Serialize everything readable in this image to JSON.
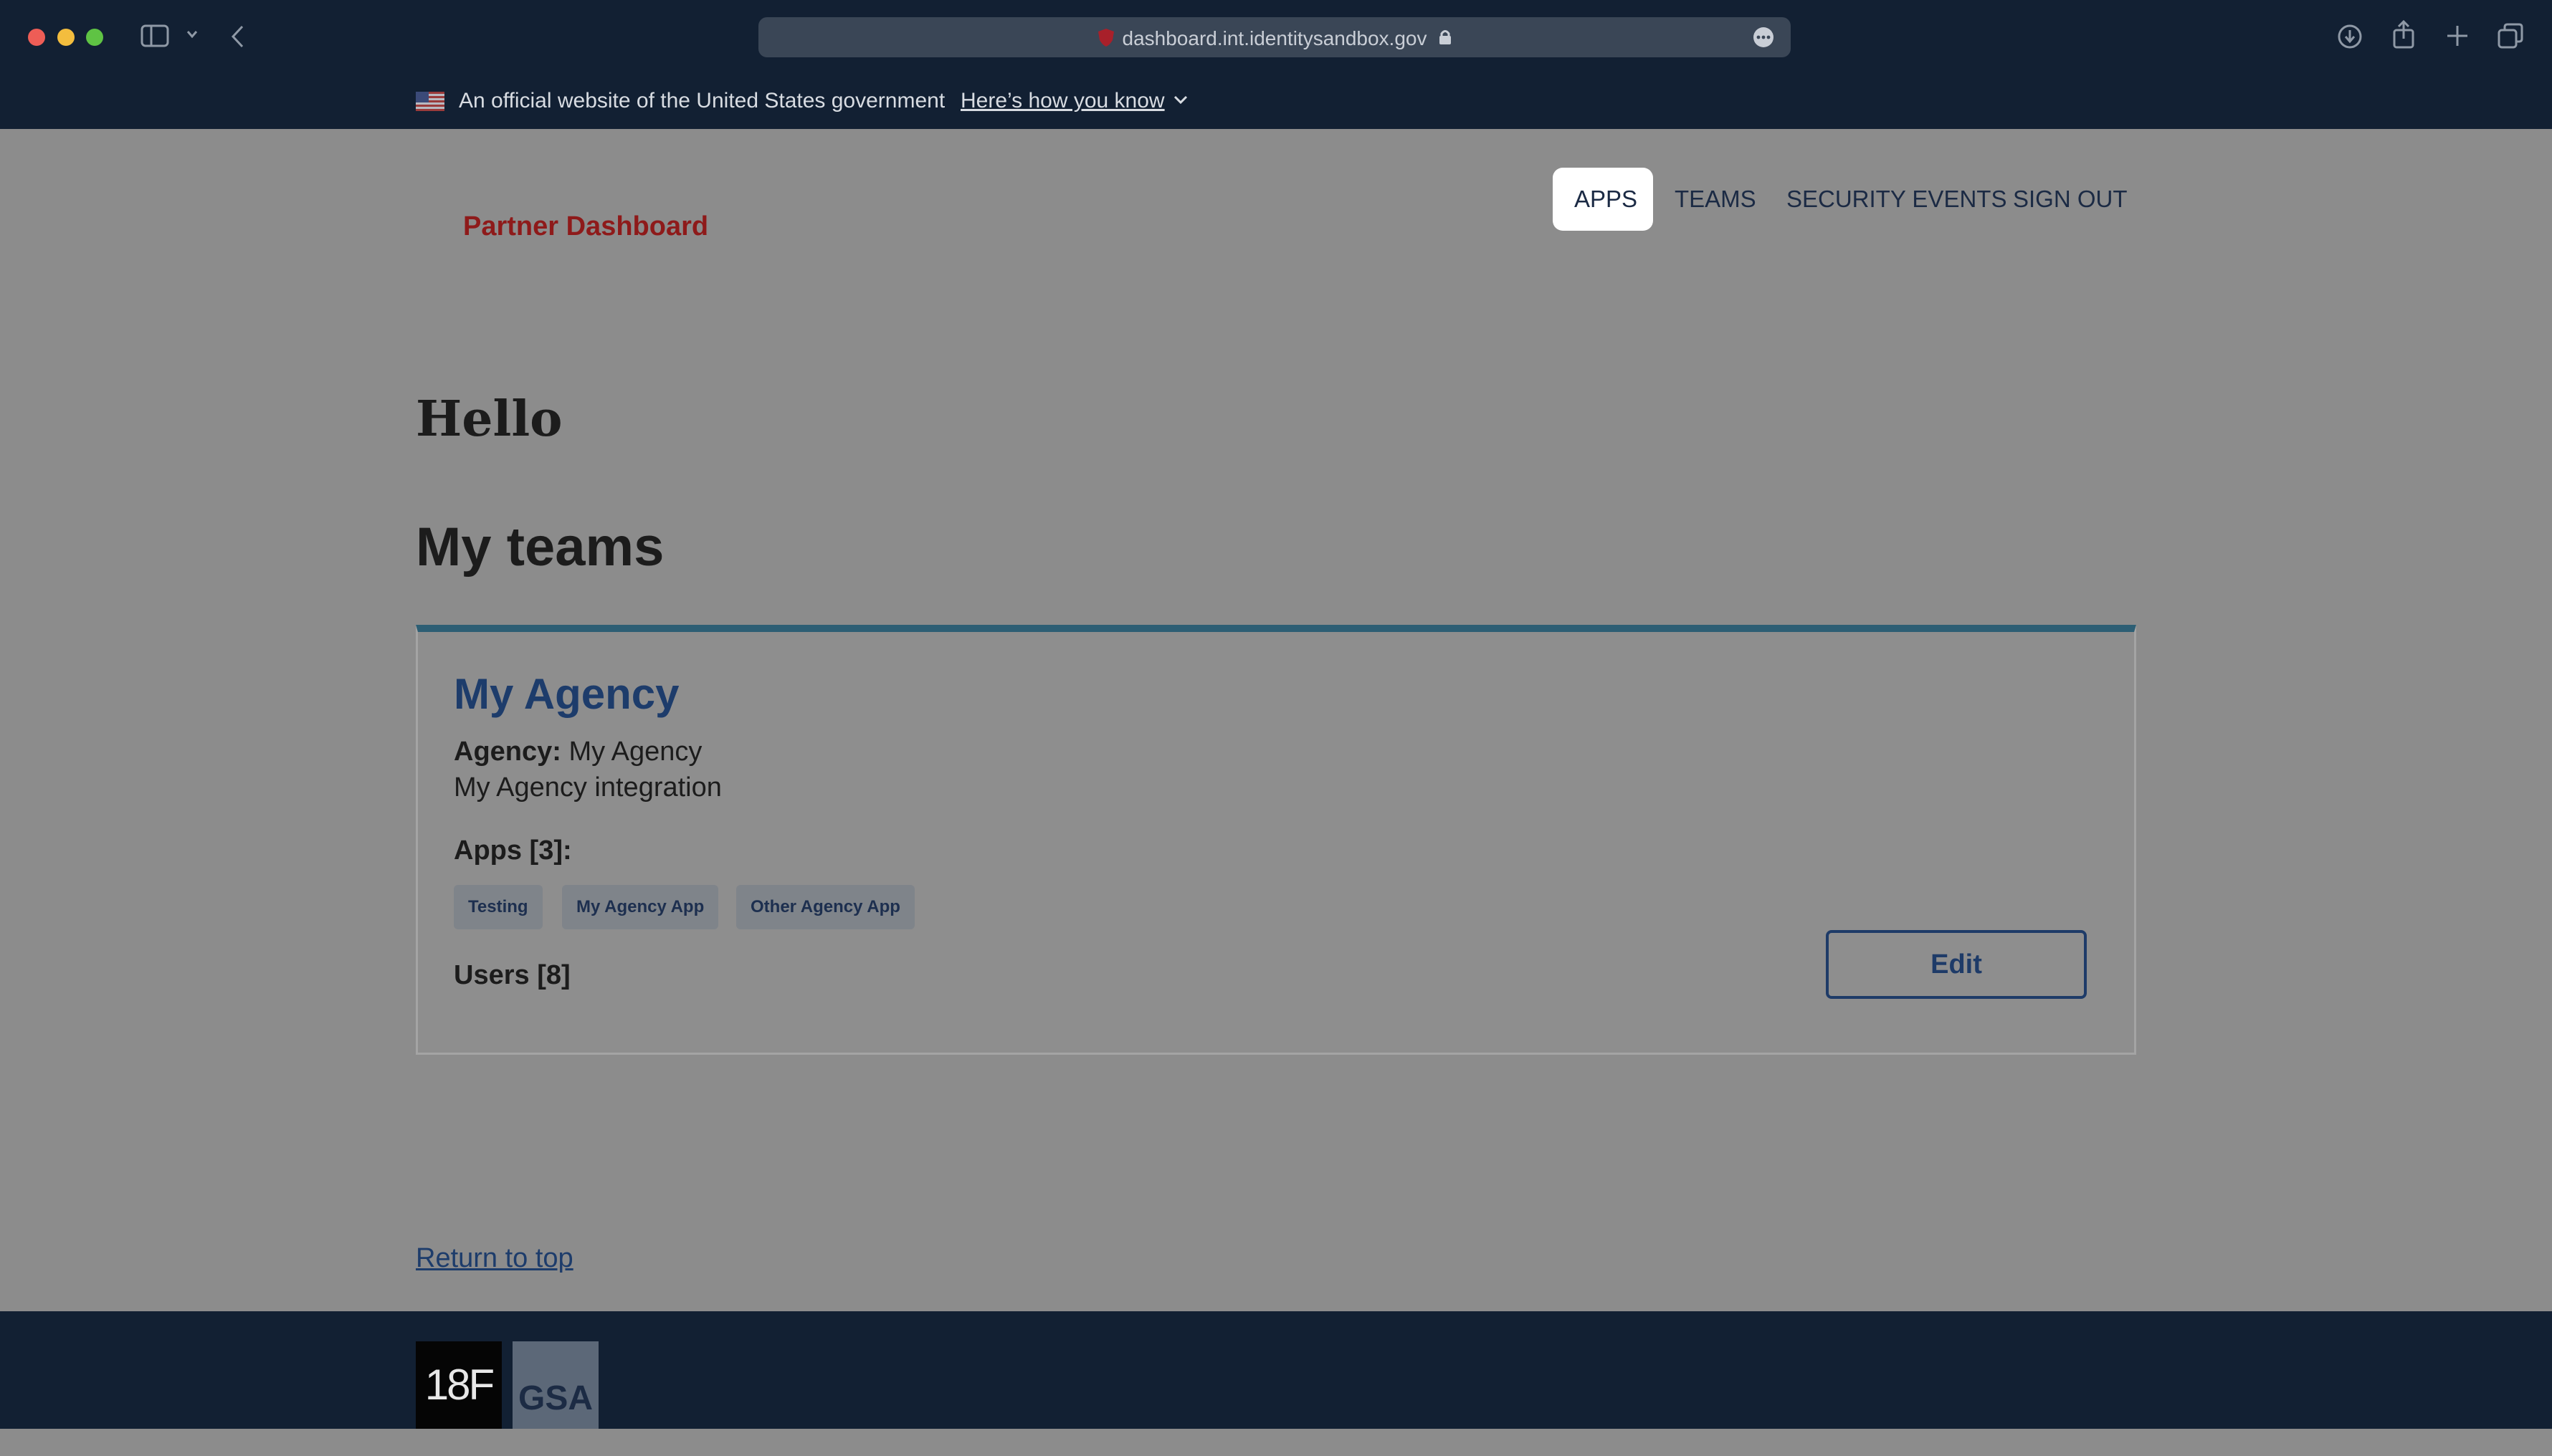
{
  "browser": {
    "url": "dashboard.int.identitysandbox.gov"
  },
  "gov_banner": {
    "text": "An official website of the United States government",
    "link": "Here’s how you know"
  },
  "header": {
    "brand": "Partner Dashboard",
    "nav": [
      "APPS",
      "TEAMS",
      "SECURITY EVENTS",
      "SIGN OUT"
    ],
    "active_nav": "APPS"
  },
  "main": {
    "greeting": "Hello",
    "section_title": "My teams",
    "team": {
      "name": "My Agency",
      "agency_label": "Agency:",
      "agency_value": "My Agency",
      "description": "My Agency integration",
      "apps_label": "Apps [3]:",
      "apps": [
        "Testing",
        "My Agency App",
        "Other Agency App"
      ],
      "users_label": "Users [8]",
      "edit_label": "Edit"
    },
    "return_to_top": "Return to top"
  },
  "footer": {
    "logo_18f": "18F",
    "logo_gsa": "GSA"
  },
  "colors": {
    "chrome_bg": "#122033",
    "page_overlay": "#8c8c8c",
    "brand": "#8e1a1a",
    "link": "#1d3c6b",
    "card_accent": "#2d5e74"
  }
}
